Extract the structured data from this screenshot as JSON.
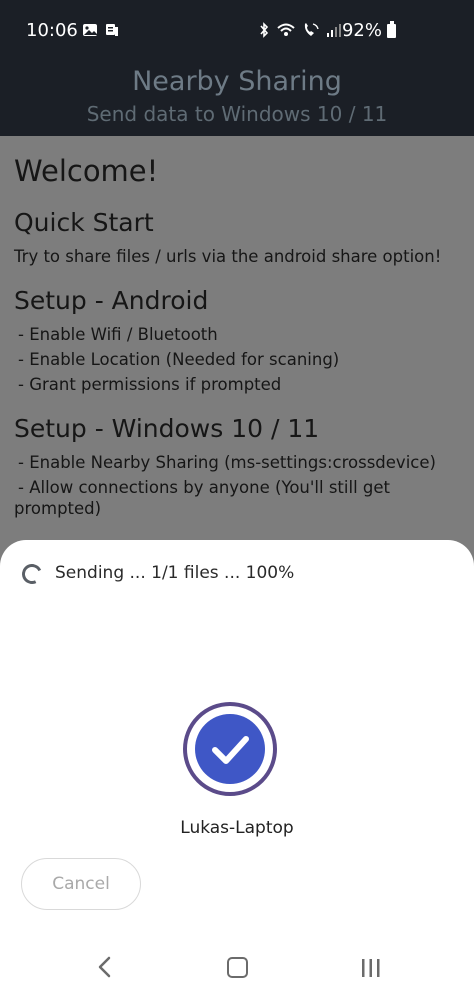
{
  "status_bar": {
    "time": "10:06",
    "battery": "92%",
    "icons_left": [
      "gallery-icon",
      "notification-icon"
    ],
    "icons_right": [
      "bluetooth-icon",
      "wifi-icon",
      "call-icon",
      "signal-icon",
      "battery-icon"
    ]
  },
  "header": {
    "title": "Nearby Sharing",
    "subtitle": "Send data to Windows 10 / 11"
  },
  "content": {
    "welcome": "Welcome!",
    "quick_start_title": "Quick Start",
    "quick_start_text": "Try to share files / urls via the android share option!",
    "setup_android_title": "Setup - Android",
    "setup_android_items": [
      "- Enable Wifi / Bluetooth",
      "- Enable Location (Needed for scaning)",
      "- Grant permissions if prompted"
    ],
    "setup_windows_title": "Setup - Windows 10 / 11",
    "setup_windows_items": [
      "- Enable Nearby Sharing (ms-settings:crossdevice)",
      "- Allow connections by anyone (You'll still get",
      "prompted)"
    ]
  },
  "sheet": {
    "status_text": "Sending ... 1/1 files ... 100%",
    "device_name": "Lukas-Laptop",
    "cancel_label": "Cancel"
  },
  "colors": {
    "header_bg": "#1b1f26",
    "dim_overlay": "#7d7d7d",
    "device_fill": "#3f57c6",
    "device_ring": "#5b4b8a"
  }
}
